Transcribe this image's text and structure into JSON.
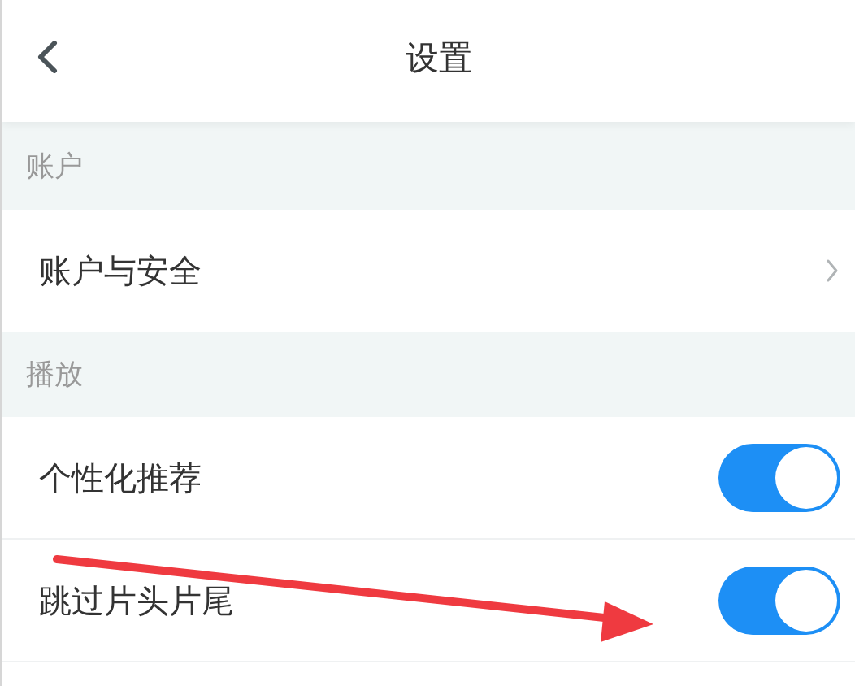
{
  "header": {
    "title": "设置"
  },
  "sections": [
    {
      "label": "账户",
      "items": [
        {
          "kind": "link",
          "label": "账户与安全"
        }
      ]
    },
    {
      "label": "播放",
      "items": [
        {
          "kind": "toggle",
          "label": "个性化推荐",
          "on": true
        },
        {
          "kind": "toggle",
          "label": "跳过片头片尾",
          "on": true
        }
      ]
    }
  ]
}
